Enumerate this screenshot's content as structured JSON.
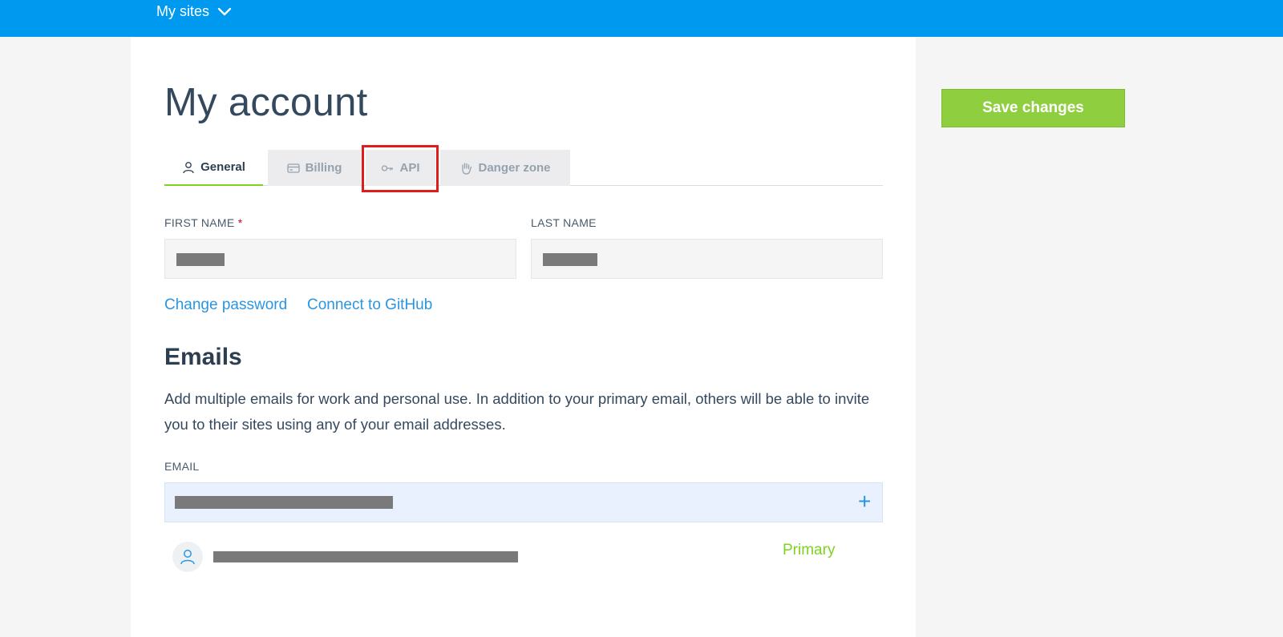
{
  "topbar": {
    "my_sites_label": "My sites"
  },
  "page": {
    "title": "My account"
  },
  "tabs": [
    {
      "label": "General",
      "icon": "user-icon",
      "active": true
    },
    {
      "label": "Billing",
      "icon": "credit-card-icon",
      "active": false
    },
    {
      "label": "API",
      "icon": "key-icon",
      "active": false
    },
    {
      "label": "Danger zone",
      "icon": "hand-icon",
      "active": false
    }
  ],
  "form": {
    "first_name_label": "FIRST NAME",
    "required_marker": "*",
    "last_name_label": "LAST NAME",
    "first_name_value": "",
    "last_name_value": ""
  },
  "links": {
    "change_password": "Change password",
    "connect_github": "Connect to GitHub"
  },
  "emails": {
    "title": "Emails",
    "description": "Add multiple emails for work and personal use. In addition to your primary email, others will be able to invite you to their sites using any of your email addresses.",
    "email_label": "EMAIL",
    "add_icon": "plus-icon",
    "primary_badge": "Primary"
  },
  "actions": {
    "save_label": "Save changes"
  },
  "colors": {
    "topbar": "#0099f0",
    "save_button": "#8ece3f",
    "link": "#2b95e0",
    "primary_badge": "#7ed321",
    "highlight": "#e01b1b"
  }
}
